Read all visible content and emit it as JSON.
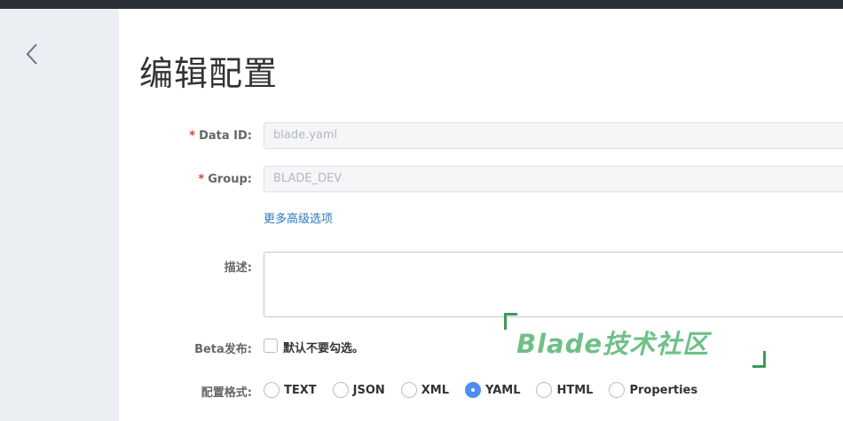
{
  "page": {
    "title": "编辑配置"
  },
  "form": {
    "data_id": {
      "label": "Data ID:",
      "value": "blade.yaml",
      "required_mark": "*"
    },
    "group": {
      "label": "Group:",
      "value": "BLADE_DEV",
      "required_mark": "*"
    },
    "advanced_link": "更多高级选项",
    "description": {
      "label": "描述:",
      "value": ""
    },
    "beta": {
      "label": "Beta发布:",
      "checkbox_text": "默认不要勾选。",
      "checked": false
    },
    "format": {
      "label": "配置格式:",
      "options": [
        "TEXT",
        "JSON",
        "XML",
        "YAML",
        "HTML",
        "Properties"
      ],
      "selected": "YAML"
    }
  },
  "watermark": {
    "text": "Blade技术社区"
  },
  "colors": {
    "accent": "#4d8cf5",
    "link": "#2b79c2",
    "required": "#e0412b",
    "watermark": "#6fc087",
    "sidebar": "#ebeef3",
    "topbar": "#2b2f36"
  },
  "icons": {
    "back": "chevron-left-icon"
  }
}
